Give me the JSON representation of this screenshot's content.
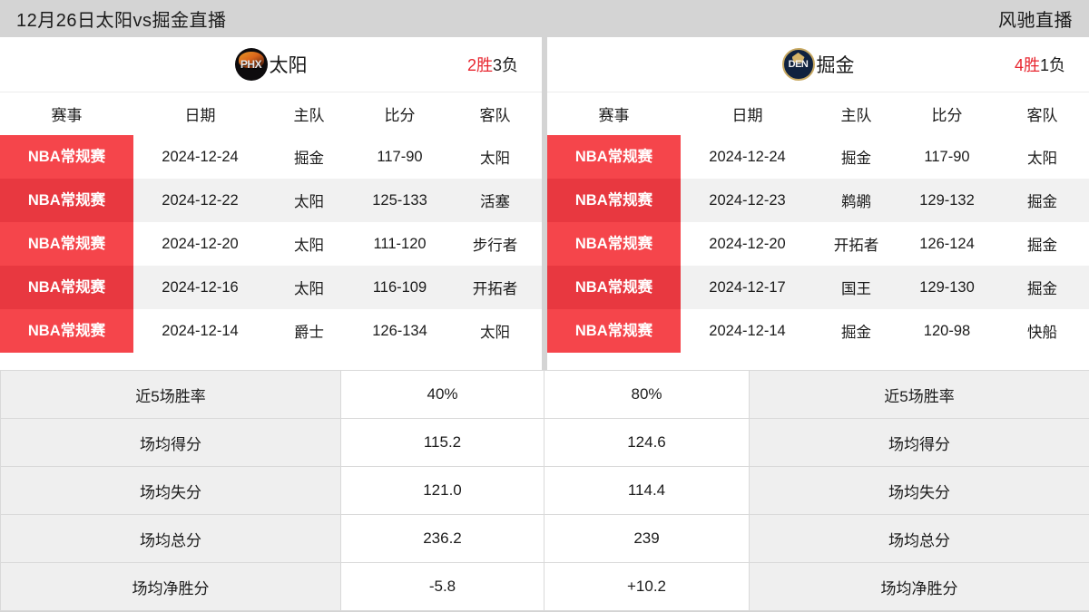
{
  "topbar": {
    "title": "12月26日太阳vs掘金直播",
    "brand": "风驰直播"
  },
  "left_panel": {
    "team": {
      "logo_text": "PHX",
      "logo_name": "suns-logo",
      "name": "太阳",
      "wins": "2胜",
      "losses": "3负"
    },
    "columns": [
      "赛事",
      "日期",
      "主队",
      "比分",
      "客队"
    ],
    "rows": [
      {
        "event": "NBA常规赛",
        "date": "2024-12-24",
        "home": "掘金",
        "score": "117-90",
        "away": "太阳"
      },
      {
        "event": "NBA常规赛",
        "date": "2024-12-22",
        "home": "太阳",
        "score": "125-133",
        "away": "活塞"
      },
      {
        "event": "NBA常规赛",
        "date": "2024-12-20",
        "home": "太阳",
        "score": "111-120",
        "away": "步行者"
      },
      {
        "event": "NBA常规赛",
        "date": "2024-12-16",
        "home": "太阳",
        "score": "116-109",
        "away": "开拓者"
      },
      {
        "event": "NBA常规赛",
        "date": "2024-12-14",
        "home": "爵士",
        "score": "126-134",
        "away": "太阳"
      }
    ]
  },
  "right_panel": {
    "team": {
      "logo_text": "DEN",
      "logo_name": "nuggets-logo",
      "name": "掘金",
      "wins": "4胜",
      "losses": "1负"
    },
    "columns": [
      "赛事",
      "日期",
      "主队",
      "比分",
      "客队"
    ],
    "rows": [
      {
        "event": "NBA常规赛",
        "date": "2024-12-24",
        "home": "掘金",
        "score": "117-90",
        "away": "太阳"
      },
      {
        "event": "NBA常规赛",
        "date": "2024-12-23",
        "home": "鹈鹕",
        "score": "129-132",
        "away": "掘金"
      },
      {
        "event": "NBA常规赛",
        "date": "2024-12-20",
        "home": "开拓者",
        "score": "126-124",
        "away": "掘金"
      },
      {
        "event": "NBA常规赛",
        "date": "2024-12-17",
        "home": "国王",
        "score": "129-130",
        "away": "掘金"
      },
      {
        "event": "NBA常规赛",
        "date": "2024-12-14",
        "home": "掘金",
        "score": "120-98",
        "away": "快船"
      }
    ]
  },
  "stats": {
    "rows": [
      {
        "left_label": "近5场胜率",
        "left_value": "40%",
        "right_value": "80%",
        "right_label": "近5场胜率"
      },
      {
        "left_label": "场均得分",
        "left_value": "115.2",
        "right_value": "124.6",
        "right_label": "场均得分"
      },
      {
        "left_label": "场均失分",
        "left_value": "121.0",
        "right_value": "114.4",
        "right_label": "场均失分"
      },
      {
        "left_label": "场均总分",
        "left_value": "236.2",
        "right_value": "239",
        "right_label": "场均总分"
      },
      {
        "left_label": "场均净胜分",
        "left_value": "-5.8",
        "right_value": "+10.2",
        "right_label": "场均净胜分"
      }
    ]
  },
  "colors": {
    "page_background": "#d4d4d4",
    "badge_light": "#f5454b",
    "badge_dark": "#e83840",
    "accent_red": "#e8262f",
    "row_alt": "#f1f1f1",
    "stat_label_bg": "#efefef"
  }
}
